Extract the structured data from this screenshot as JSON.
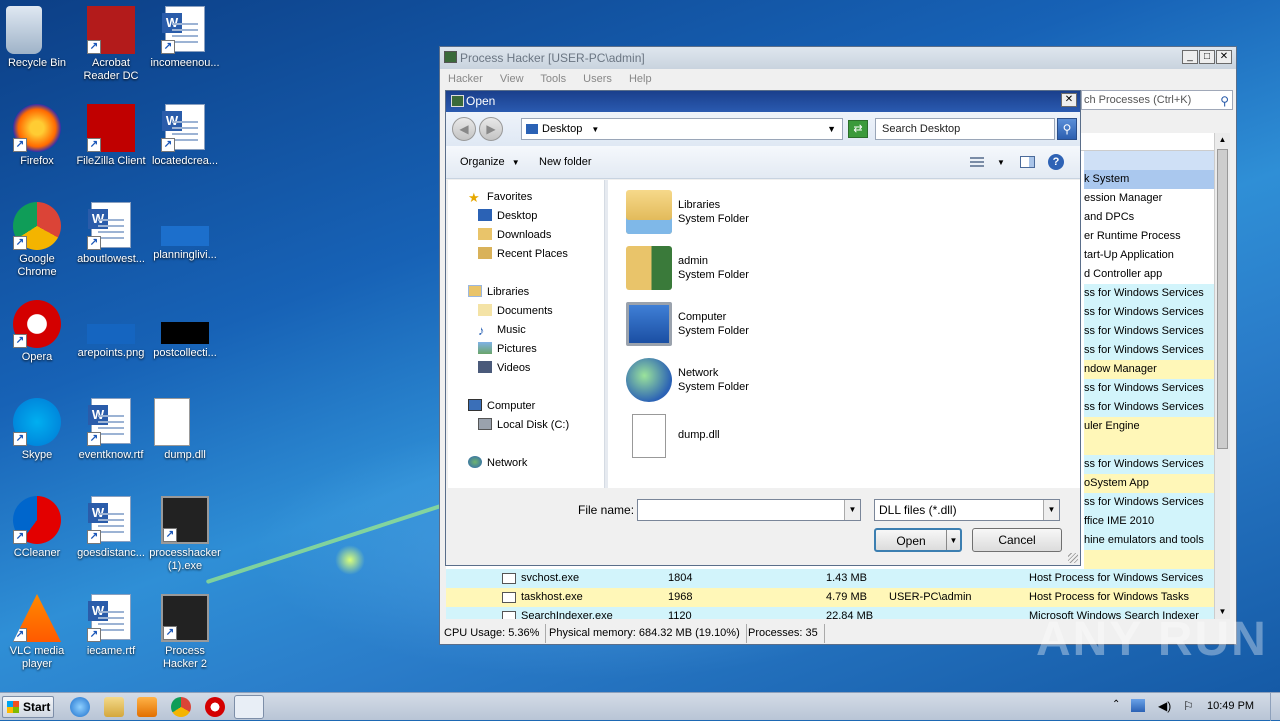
{
  "desktop_icons": [
    {
      "label": "Recycle Bin"
    },
    {
      "label": "Acrobat Reader DC"
    },
    {
      "label": "incomeenou..."
    },
    {
      "label": "Firefox"
    },
    {
      "label": "FileZilla Client"
    },
    {
      "label": "locatedcrea..."
    },
    {
      "label": "Google Chrome"
    },
    {
      "label": "aboutlowest..."
    },
    {
      "label": "planninglivi..."
    },
    {
      "label": "Opera"
    },
    {
      "label": "arepoints.png"
    },
    {
      "label": "postcollecti..."
    },
    {
      "label": "Skype"
    },
    {
      "label": "eventknow.rtf"
    },
    {
      "label": "dump.dll"
    },
    {
      "label": "CCleaner"
    },
    {
      "label": "goesdistanc..."
    },
    {
      "label": "processhacker (1).exe"
    },
    {
      "label": "VLC media player"
    },
    {
      "label": "iecame.rtf"
    },
    {
      "label": "Process Hacker 2"
    }
  ],
  "process_hacker": {
    "title": "Process Hacker [USER-PC\\admin]",
    "menu": [
      "Hacker",
      "View",
      "Tools",
      "Users",
      "Help"
    ],
    "search_placeholder": "Search Processes (Ctrl+K)",
    "search_visible": "ch Processes (Ctrl+K)",
    "desc_rows": [
      {
        "text": "",
        "color": "#cfe0f6"
      },
      {
        "text": "k System",
        "color": "#aac8ee"
      },
      {
        "text": "ession Manager",
        "color": "#ffffff"
      },
      {
        "text": "and DPCs",
        "color": "#ffffff"
      },
      {
        "text": "er Runtime Process",
        "color": "#ffffff"
      },
      {
        "text": "tart-Up Application",
        "color": "#ffffff"
      },
      {
        "text": "d Controller app",
        "color": "#ffffff"
      },
      {
        "text": "ss for Windows Services",
        "color": "#d2f4fb"
      },
      {
        "text": "ss for Windows Services",
        "color": "#d2f4fb"
      },
      {
        "text": "ss for Windows Services",
        "color": "#d2f4fb"
      },
      {
        "text": "ss for Windows Services",
        "color": "#d2f4fb"
      },
      {
        "text": "ndow Manager",
        "color": "#fff7b8"
      },
      {
        "text": "ss for Windows Services",
        "color": "#d2f4fb"
      },
      {
        "text": "ss for Windows Services",
        "color": "#d2f4fb"
      },
      {
        "text": "uler Engine",
        "color": "#fff7b8"
      },
      {
        "text": "",
        "color": "#fff7b8"
      },
      {
        "text": "ss for Windows Services",
        "color": "#d2f4fb"
      },
      {
        "text": "oSystem App",
        "color": "#fff7b8"
      },
      {
        "text": "ss for Windows Services",
        "color": "#d2f4fb"
      },
      {
        "text": "ffice IME 2010",
        "color": "#d2f4fb"
      },
      {
        "text": "hine emulators and tools",
        "color": "#d2f4fb"
      },
      {
        "text": "",
        "color": "#fff7b8"
      }
    ],
    "rows": [
      {
        "name": "svchost.exe",
        "pid": "1804",
        "mem": "1.43 MB",
        "user": "",
        "desc": "Host Process for Windows Services",
        "color": "#d2f4fb"
      },
      {
        "name": "taskhost.exe",
        "pid": "1968",
        "mem": "4.79 MB",
        "user": "USER-PC\\admin",
        "desc": "Host Process for Windows Tasks",
        "color": "#fff7b8"
      },
      {
        "name": "SearchIndexer.exe",
        "pid": "1120",
        "mem": "22.84 MB",
        "user": "",
        "desc": "Microsoft Windows Search Indexer",
        "color": "#d2f4fb"
      }
    ],
    "status": {
      "cpu": "CPU Usage: 5.36%",
      "memory": "Physical memory: 684.32 MB (19.10%)",
      "processes": "Processes: 35"
    }
  },
  "open_dialog": {
    "title": "Open",
    "location": "Desktop",
    "search_placeholder": "Search Desktop",
    "toolbar": {
      "organize": "Organize",
      "new_folder": "New folder"
    },
    "nav": {
      "favorites": "Favorites",
      "favorites_items": [
        "Desktop",
        "Downloads",
        "Recent Places"
      ],
      "libraries": "Libraries",
      "libraries_items": [
        "Documents",
        "Music",
        "Pictures",
        "Videos"
      ],
      "computer": "Computer",
      "computer_items": [
        "Local Disk (C:)"
      ],
      "network": "Network"
    },
    "items": [
      {
        "name": "Libraries",
        "type": "System Folder",
        "icon": "libraries-icon"
      },
      {
        "name": "admin",
        "type": "System Folder",
        "icon": "user-folder-icon"
      },
      {
        "name": "Computer",
        "type": "System Folder",
        "icon": "computer-icon"
      },
      {
        "name": "Network",
        "type": "System Folder",
        "icon": "network-icon"
      },
      {
        "name": "dump.dll",
        "type": "",
        "icon": "dll-file-icon"
      }
    ],
    "file_name_label": "File name:",
    "file_name_value": "",
    "file_type": "DLL files (*.dll)",
    "open_label": "Open",
    "cancel_label": "Cancel"
  },
  "taskbar": {
    "start_label": "Start",
    "clock": "10:49 PM"
  },
  "watermark": "ANY RUN"
}
